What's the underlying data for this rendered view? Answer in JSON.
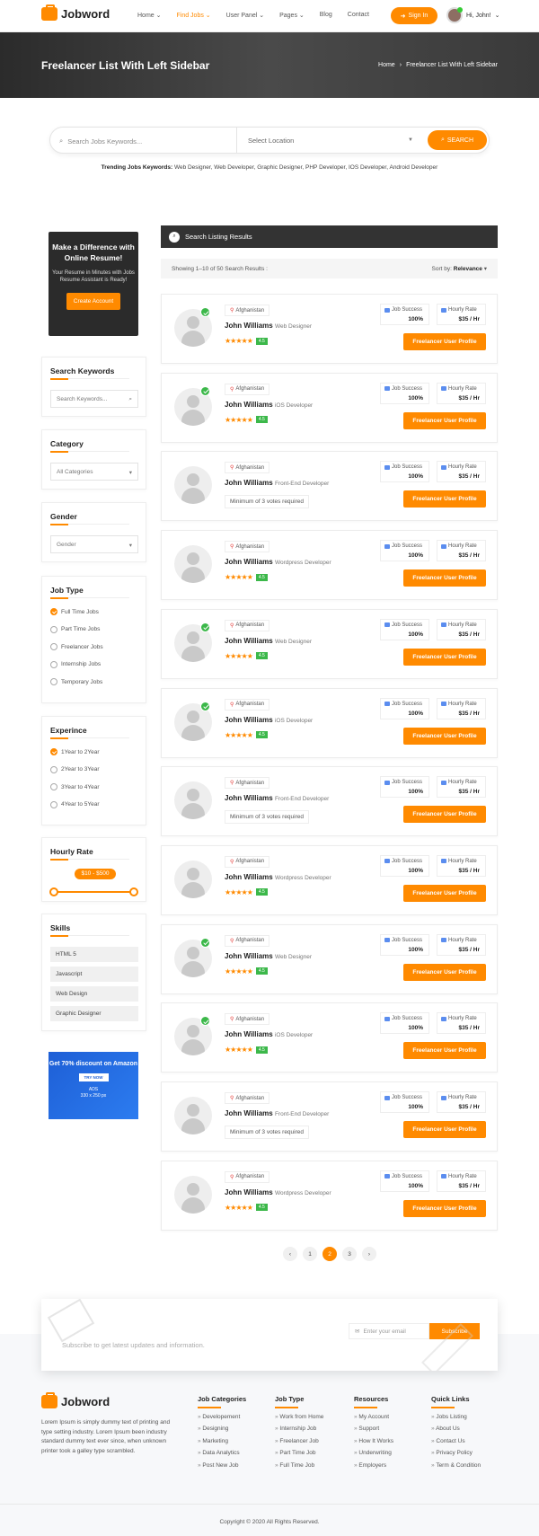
{
  "header": {
    "logo": "Jobword",
    "nav": [
      "Home",
      "Find Jobs",
      "User Panel",
      "Pages",
      "Blog",
      "Contact"
    ],
    "nav_active": 1,
    "signin": "Sign In",
    "greeting": "Hi, John!"
  },
  "banner": {
    "title": "Freelancer List With Left Sidebar",
    "breadcrumb_home": "Home",
    "breadcrumb_sep": "›",
    "breadcrumb_current": "Freelancer List With Left Sidebar"
  },
  "search": {
    "keyword_placeholder": "Search Jobs Keywords...",
    "location_placeholder": "Select Location",
    "button": "SEARCH",
    "trending_label": "Trending Jobs Keywords:",
    "trending": "Web Designer, Web Developer, Graphic Designer, PHP Developer, IOS Developer, Android Developer"
  },
  "sidebar": {
    "promo": {
      "title": "Make a Difference with Online Resume!",
      "text": "Your Resume in Minutes with Jobs Resume Assistant is Ready!",
      "button": "Create Account"
    },
    "keywords": {
      "title": "Search Keywords",
      "placeholder": "Search Keywords..."
    },
    "category": {
      "title": "Category",
      "value": "All Categories"
    },
    "gender": {
      "title": "Gender",
      "value": "Gender"
    },
    "job_type": {
      "title": "Job Type",
      "options": [
        "Full Time Jobs",
        "Part Time Jobs",
        "Freelancer Jobs",
        "Internship Jobs",
        "Temporary Jobs"
      ],
      "selected": 0
    },
    "experience": {
      "title": "Experince",
      "options": [
        "1Year to 2Year",
        "2Year to 3Year",
        "3Year to 4Year",
        "4Year to 5Year"
      ],
      "selected": 0
    },
    "hourly": {
      "title": "Hourly Rate",
      "range": "$10 - $500"
    },
    "skills": {
      "title": "Skills",
      "items": [
        "HTML 5",
        "Javascript",
        "Web Design",
        "Graphic Designer"
      ]
    },
    "ad": {
      "title": "Get 70% discount on Amazon",
      "button": "TRY NOW",
      "label": "ADS",
      "size": "330 x 250 px"
    }
  },
  "listing": {
    "title": "Search Listing Results",
    "showing": "Showing 1–10 of 50 Search Results :",
    "sort_label": "Sort by:",
    "sort_value": "Relevance",
    "stat1_label": "Job Success",
    "stat2_label": "Hourly Rate",
    "profile_button": "Freelancer User Profile",
    "cards": [
      {
        "location": "Afghanistan",
        "name": "John Williams",
        "role": "Web Designer",
        "verified": true,
        "rating": "4.5",
        "votes": "",
        "success": "100%",
        "rate": "$35 / Hr"
      },
      {
        "location": "Afghanistan",
        "name": "John Williams",
        "role": "iOS Developer",
        "verified": true,
        "rating": "4.5",
        "votes": "",
        "success": "100%",
        "rate": "$35 / Hr"
      },
      {
        "location": "Afghanistan",
        "name": "John Williams",
        "role": "Front-End Developer",
        "verified": false,
        "rating": "",
        "votes": "Minimum of 3 votes required",
        "success": "100%",
        "rate": "$35 / Hr"
      },
      {
        "location": "Afghanistan",
        "name": "John Williams",
        "role": "Wordpress Developer",
        "verified": false,
        "rating": "4.5",
        "votes": "",
        "success": "100%",
        "rate": "$35 / Hr"
      },
      {
        "location": "Afghanistan",
        "name": "John Williams",
        "role": "Web Designer",
        "verified": true,
        "rating": "4.5",
        "votes": "",
        "success": "100%",
        "rate": "$35 / Hr"
      },
      {
        "location": "Afghanistan",
        "name": "John Williams",
        "role": "iOS Developer",
        "verified": true,
        "rating": "4.5",
        "votes": "",
        "success": "100%",
        "rate": "$35 / Hr"
      },
      {
        "location": "Afghanistan",
        "name": "John Williams",
        "role": "Front-End Developer",
        "verified": false,
        "rating": "",
        "votes": "Minimum of 3 votes required",
        "success": "100%",
        "rate": "$35 / Hr"
      },
      {
        "location": "Afghanistan",
        "name": "John Williams",
        "role": "Wordpress Developer",
        "verified": false,
        "rating": "4.5",
        "votes": "",
        "success": "100%",
        "rate": "$35 / Hr"
      },
      {
        "location": "Afghanistan",
        "name": "John Williams",
        "role": "Web Designer",
        "verified": true,
        "rating": "4.5",
        "votes": "",
        "success": "100%",
        "rate": "$35 / Hr"
      },
      {
        "location": "Afghanistan",
        "name": "John Williams",
        "role": "iOS Developer",
        "verified": true,
        "rating": "4.5",
        "votes": "",
        "success": "100%",
        "rate": "$35 / Hr"
      },
      {
        "location": "Afghanistan",
        "name": "John Williams",
        "role": "Front-End Developer",
        "verified": false,
        "rating": "",
        "votes": "Minimum of 3 votes required",
        "success": "100%",
        "rate": "$35 / Hr"
      },
      {
        "location": "Afghanistan",
        "name": "John Williams",
        "role": "Wordpress Developer",
        "verified": false,
        "rating": "4.5",
        "votes": "",
        "success": "100%",
        "rate": "$35 / Hr"
      }
    ]
  },
  "pagination": {
    "pages": [
      "1",
      "2",
      "3"
    ],
    "current": 1
  },
  "subscribe": {
    "text": "Subscribe to get latest updates and information.",
    "placeholder": "Enter your email",
    "button": "Subscribe"
  },
  "footer": {
    "logo": "Jobword",
    "description": "Lorem Ipsum is simply dummy text of printing and type setting industry. Lorem Ipsum been industry standard dummy text ever since, when unknown printer took a galley type scrambled.",
    "columns": [
      {
        "title": "Job Categories",
        "links": [
          "Developement",
          "Designing",
          "Marketing",
          "Data Analytics",
          "Post New Job"
        ]
      },
      {
        "title": "Job Type",
        "links": [
          "Work from Home",
          "Internship Job",
          "Freelancer Job",
          "Part Time Job",
          "Full Time Job"
        ]
      },
      {
        "title": "Resources",
        "links": [
          "My Account",
          "Support",
          "How It Works",
          "Underwriting",
          "Employers"
        ]
      },
      {
        "title": "Quick Links",
        "links": [
          "Jobs Listing",
          "About Us",
          "Contact Us",
          "Privacy Policy",
          "Term & Condition"
        ]
      }
    ],
    "copyright": "Copyright © 2020 All Rights Reserved."
  },
  "colors": {
    "accent": "#ff8a00",
    "dark": "#333333",
    "verified": "#3cb84a"
  }
}
